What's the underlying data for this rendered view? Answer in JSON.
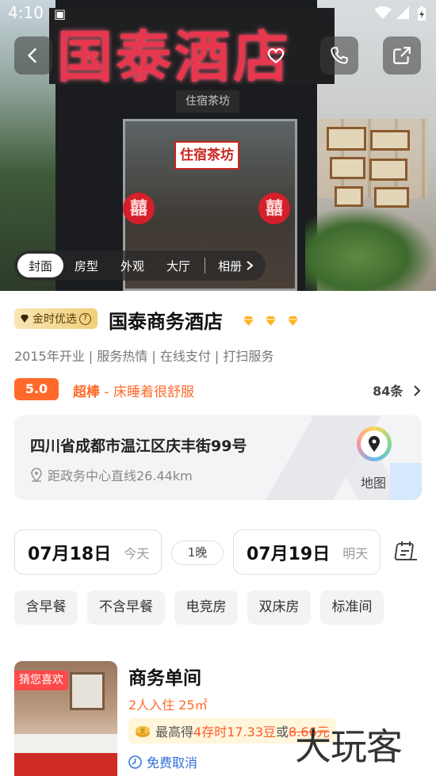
{
  "status_bar": {
    "time": "4:10"
  },
  "hero": {
    "sign_text": "国泰酒店",
    "door_sign": "住宿茶坊",
    "upper_sign": "住宿茶坊",
    "xi_char": "囍",
    "tabs": [
      "封面",
      "房型",
      "外观",
      "大厅",
      "相册"
    ],
    "active_tab": "封面"
  },
  "hotel": {
    "badge": "金时优选",
    "name": "国泰商务酒店",
    "diamond_count": 3,
    "tags": "2015年开业 | 服务热情 | 在线支付 | 打扫服务",
    "score": "5.0",
    "score_word": "超棒",
    "score_comment": " - 床睡着很舒服",
    "review_count": "84条",
    "accent_color": "#ff6a2b"
  },
  "address": {
    "line": "四川省成都市温江区庆丰街99号",
    "distance": "距政务中心直线26.44km",
    "map_label": "地图"
  },
  "dates": {
    "checkin": "07月18日",
    "checkin_label": "今天",
    "nights": "1晚",
    "checkout": "07月19日",
    "checkout_label": "明天"
  },
  "filters": [
    "含早餐",
    "不含早餐",
    "电竞房",
    "双床房",
    "标准间"
  ],
  "room": {
    "tag": "猜您喜欢",
    "title": "商务单间",
    "sub": "2人入住 25㎡",
    "earn_prefix": "最高得",
    "earn_highlight": "4存时17.33豆",
    "earn_or": "或",
    "earn_strike": "8.66元",
    "cancel": "免费取消"
  },
  "watermark": "大玩客"
}
